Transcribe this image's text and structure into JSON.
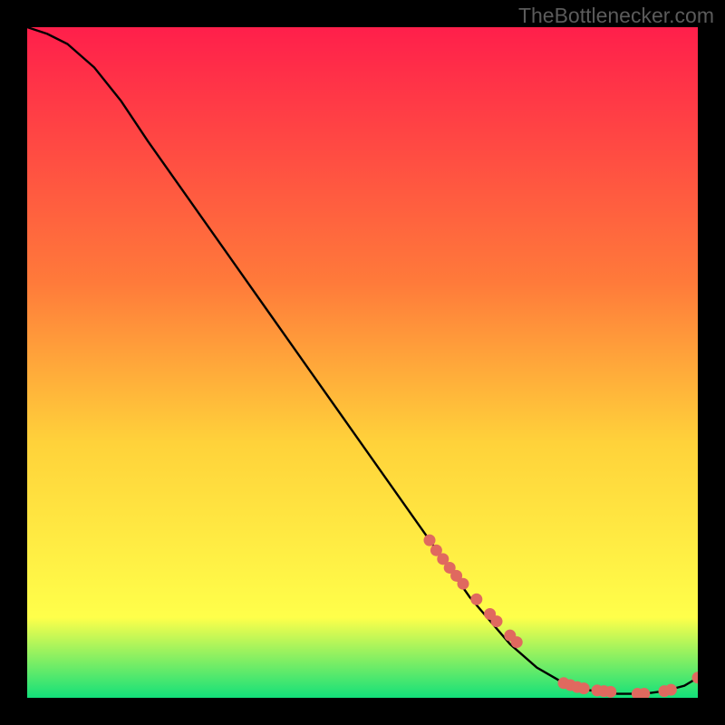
{
  "watermark": "TheBottlenecker.com",
  "colors": {
    "gradient_top": "#ff1f4b",
    "gradient_mid1": "#ff7a3a",
    "gradient_mid2": "#ffd23a",
    "gradient_mid3": "#ffff4a",
    "gradient_bottom": "#12e07a",
    "curve": "#000000",
    "marker_fill": "#e0695f",
    "marker_stroke": "#b8493f",
    "background": "#000000"
  },
  "chart_data": {
    "type": "line",
    "title": "",
    "xlabel": "",
    "ylabel": "",
    "xlim": [
      0,
      100
    ],
    "ylim": [
      0,
      100
    ],
    "grid": false,
    "legend": false,
    "series": [
      {
        "name": "curve",
        "x": [
          0,
          3,
          6,
          10,
          14,
          18,
          24,
          30,
          36,
          42,
          48,
          54,
          60,
          66,
          72,
          76,
          80,
          84,
          88,
          92,
          95,
          98,
          100
        ],
        "y": [
          100,
          99,
          97.5,
          94,
          89,
          83,
          74.5,
          66,
          57.5,
          49,
          40.5,
          32,
          23.5,
          15,
          8,
          4.5,
          2.2,
          1.1,
          0.6,
          0.6,
          1.0,
          1.8,
          3.0
        ]
      }
    ],
    "markers": {
      "name": "highlight-points",
      "x": [
        60,
        61,
        62,
        63,
        64,
        65,
        67,
        69,
        70,
        72,
        73,
        80,
        81,
        82,
        83,
        85,
        86,
        87,
        91,
        92,
        95,
        96,
        100
      ],
      "y": [
        23.5,
        22.0,
        20.7,
        19.4,
        18.2,
        17.0,
        14.7,
        12.5,
        11.4,
        9.3,
        8.3,
        2.2,
        1.9,
        1.6,
        1.4,
        1.1,
        1.0,
        0.9,
        0.6,
        0.6,
        1.0,
        1.2,
        3.0
      ]
    }
  }
}
